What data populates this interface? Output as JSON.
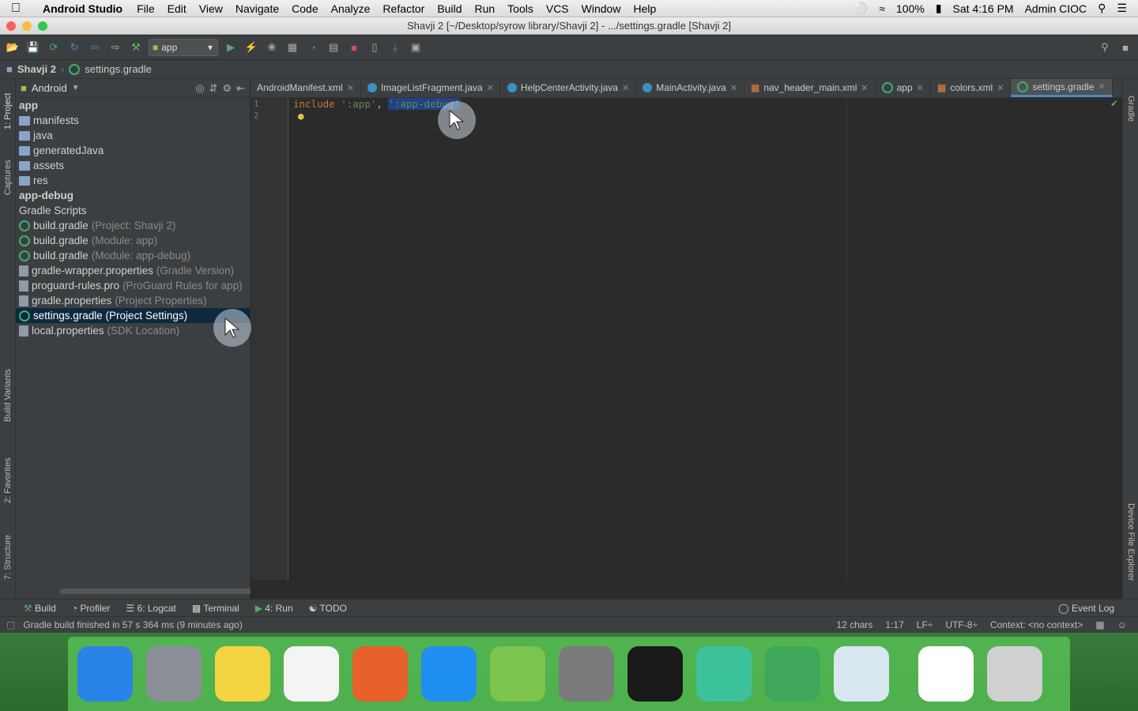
{
  "menubar": {
    "app_name": "Android Studio",
    "items": [
      "File",
      "Edit",
      "View",
      "Navigate",
      "Code",
      "Analyze",
      "Refactor",
      "Build",
      "Run",
      "Tools",
      "VCS",
      "Window",
      "Help"
    ],
    "battery": "100%",
    "clock": "Sat 4:16 PM",
    "user": "Admin CIOC"
  },
  "window": {
    "title": "Shavji 2 [~/Desktop/syrow library/Shavji 2] - .../settings.gradle [Shavji 2]"
  },
  "toolbar": {
    "run_config": "app"
  },
  "navbar": {
    "project": "Shavji 2",
    "file": "settings.gradle"
  },
  "left_strip": {
    "project": "1: Project",
    "captures": "Captures",
    "build_variants": "Build Variants",
    "favorites": "2: Favorites",
    "structure": "7: Structure"
  },
  "right_strip": {
    "gradle": "Gradle",
    "device_explorer": "Device File Explorer"
  },
  "project_panel": {
    "view_mode": "Android",
    "tree": [
      {
        "name": "app",
        "hint": "",
        "kind": "module"
      },
      {
        "name": "manifests",
        "hint": "",
        "kind": "folder"
      },
      {
        "name": "java",
        "hint": "",
        "kind": "folder"
      },
      {
        "name": "generatedJava",
        "hint": "",
        "kind": "folder"
      },
      {
        "name": "assets",
        "hint": "",
        "kind": "folder"
      },
      {
        "name": "res",
        "hint": "",
        "kind": "folder"
      },
      {
        "name": "app-debug",
        "hint": "",
        "kind": "module"
      },
      {
        "name": "Gradle Scripts",
        "hint": "",
        "kind": "group"
      },
      {
        "name": "build.gradle",
        "hint": "(Project: Shavji 2)",
        "kind": "gradle"
      },
      {
        "name": "build.gradle",
        "hint": "(Module: app)",
        "kind": "gradle"
      },
      {
        "name": "build.gradle",
        "hint": "(Module: app-debug)",
        "kind": "gradle"
      },
      {
        "name": "gradle-wrapper.properties",
        "hint": "(Gradle Version)",
        "kind": "file"
      },
      {
        "name": "proguard-rules.pro",
        "hint": "(ProGuard Rules for app)",
        "kind": "file"
      },
      {
        "name": "gradle.properties",
        "hint": "(Project Properties)",
        "kind": "file"
      },
      {
        "name": "settings.gradle (Project Settings)",
        "hint": "",
        "kind": "gradle",
        "selected": true
      },
      {
        "name": "local.properties",
        "hint": "(SDK Location)",
        "kind": "file"
      }
    ]
  },
  "editor": {
    "tabs": [
      {
        "label": "AndroidManifest.xml",
        "active": false
      },
      {
        "label": "ImageListFragment.java",
        "active": false
      },
      {
        "label": "HelpCenterActivity.java",
        "active": false
      },
      {
        "label": "MainActivity.java",
        "active": false
      },
      {
        "label": "nav_header_main.xml",
        "active": false
      },
      {
        "label": "app",
        "active": false
      },
      {
        "label": "colors.xml",
        "active": false
      },
      {
        "label": "settings.gradle",
        "active": true
      }
    ],
    "line_numbers": [
      "1",
      "2"
    ],
    "code": {
      "keyword": "include",
      "arg1": "':app'",
      "sep": ", ",
      "arg2": "':app-debug'"
    }
  },
  "bottom_tabs": [
    "Build",
    "Profiler",
    "6: Logcat",
    "Terminal",
    "4: Run",
    "TODO"
  ],
  "event_log": "Event Log",
  "status": {
    "message": "Gradle build finished in 57 s 364 ms (9 minutes ago)",
    "chars": "12 chars",
    "position": "1:17",
    "line_sep": "LF÷",
    "encoding": "UTF-8÷",
    "context": "Context: <no context>"
  },
  "dock": {
    "apps": [
      {
        "name": "finder-icon",
        "color": "#2a83e8"
      },
      {
        "name": "launchpad-icon",
        "color": "#8a8f96"
      },
      {
        "name": "notes-icon",
        "color": "#f3d33f"
      },
      {
        "name": "reminders-icon",
        "color": "#f4f4f4"
      },
      {
        "name": "firefox-icon",
        "color": "#e8602a"
      },
      {
        "name": "xcode-icon",
        "color": "#1e8ef0"
      },
      {
        "name": "simulator-icon",
        "color": "#7cc44e"
      },
      {
        "name": "system-preferences-icon",
        "color": "#7a7a7a"
      },
      {
        "name": "terminal-icon",
        "color": "#1a1a1a"
      },
      {
        "name": "atom-icon",
        "color": "#3cc29a"
      },
      {
        "name": "android-studio-icon",
        "color": "#3fa75a"
      },
      {
        "name": "preview-icon",
        "color": "#d8e6f0"
      },
      {
        "name": "document-thumbnail-icon",
        "color": "#ffffff"
      },
      {
        "name": "trash-icon",
        "color": "#d0d0d0"
      }
    ]
  }
}
